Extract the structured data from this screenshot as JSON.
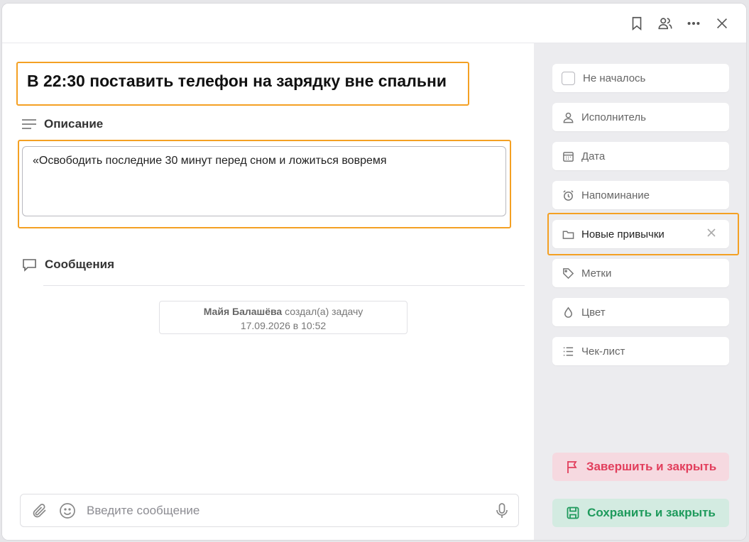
{
  "header": {
    "icons": [
      "bookmark-icon",
      "participants-icon",
      "more-icon",
      "close-icon"
    ]
  },
  "task": {
    "title": "В 22:30 поставить телефон на зарядку вне спальни",
    "description_label": "Описание",
    "description": "«Освободить последние 30 минут перед сном и ложиться вовремя"
  },
  "messages": {
    "label": "Сообщения",
    "event": {
      "author": "Майя Балашёва",
      "action": "создал(а) задачу",
      "datetime": "17.09.2026 в 10:52"
    },
    "composer_placeholder": "Введите сообщение"
  },
  "sidebar": {
    "status": "Не началось",
    "assignee": "Исполнитель",
    "date": "Дата",
    "reminder": "Напоминание",
    "project": "Новые привычки",
    "tags": "Метки",
    "color": "Цвет",
    "checklist": "Чек-лист"
  },
  "actions": {
    "finish": "Завершить и закрыть",
    "save": "Сохранить и закрыть"
  },
  "colors": {
    "highlight": "#f4a023",
    "finish_text": "#e23e5c",
    "finish_bg": "#f6d9e0",
    "save_text": "#1e9a5c",
    "save_bg": "#d3ebe1",
    "sidebar_bg": "#ececef"
  }
}
